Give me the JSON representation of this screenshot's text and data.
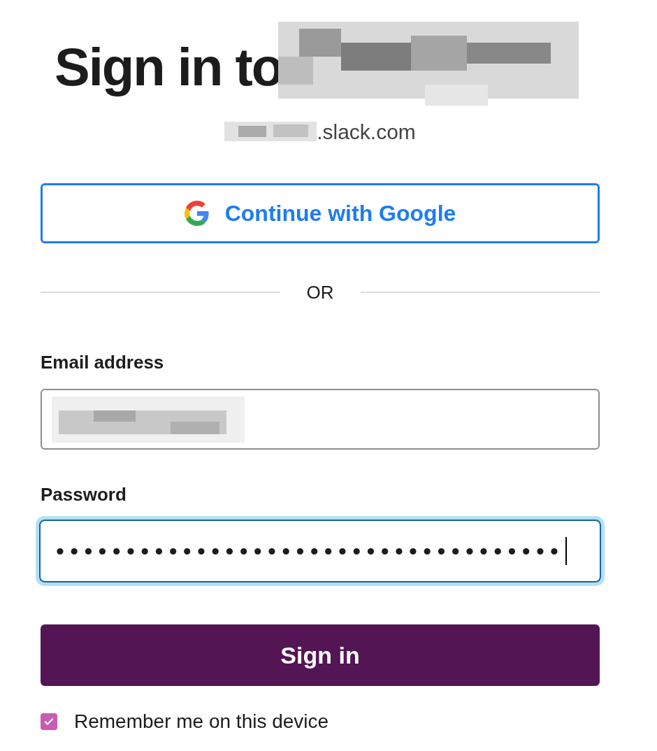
{
  "heading": "Sign in to",
  "workspace_domain": ".slack.com",
  "google_button": "Continue with Google",
  "divider": "OR",
  "email": {
    "label": "Email address"
  },
  "password": {
    "label": "Password",
    "value": "••••••••••••••••••••••••••••••••••••",
    "focused": true
  },
  "submit_button": "Sign in",
  "remember": {
    "label": "Remember me on this device",
    "checked": true
  }
}
